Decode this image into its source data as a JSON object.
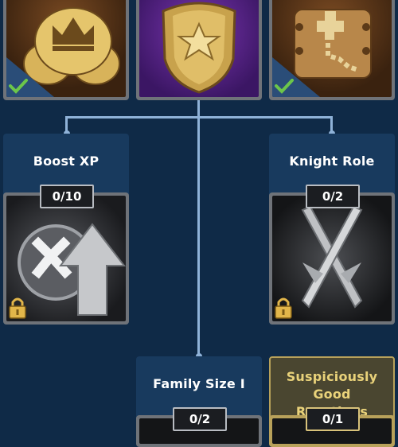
{
  "top_row": [
    {
      "icon": "crown-coins-icon",
      "completed": true
    },
    {
      "icon": "sheriff-badge-icon",
      "completed": false
    },
    {
      "icon": "treasure-map-icon",
      "completed": true
    }
  ],
  "nodes": {
    "boost_xp": {
      "title": "Boost XP",
      "progress": "0/10",
      "locked": true,
      "icon": "xp-boost-arrow-icon"
    },
    "knight_role": {
      "title": "Knight Role",
      "progress": "0/2",
      "locked": true,
      "icon": "crossed-swords-icon"
    },
    "family_size": {
      "title": "Family Size I",
      "progress": "0/2",
      "locked": false
    },
    "suspicious": {
      "title": "Suspiciously Good Reactions",
      "progress": "0/1",
      "locked": false
    }
  },
  "colors": {
    "background": "#0f2a47",
    "card": "#183a5e",
    "connector": "#8fb2d8",
    "gold_frame": "#b8a15a",
    "check_green": "#6cc64a"
  }
}
